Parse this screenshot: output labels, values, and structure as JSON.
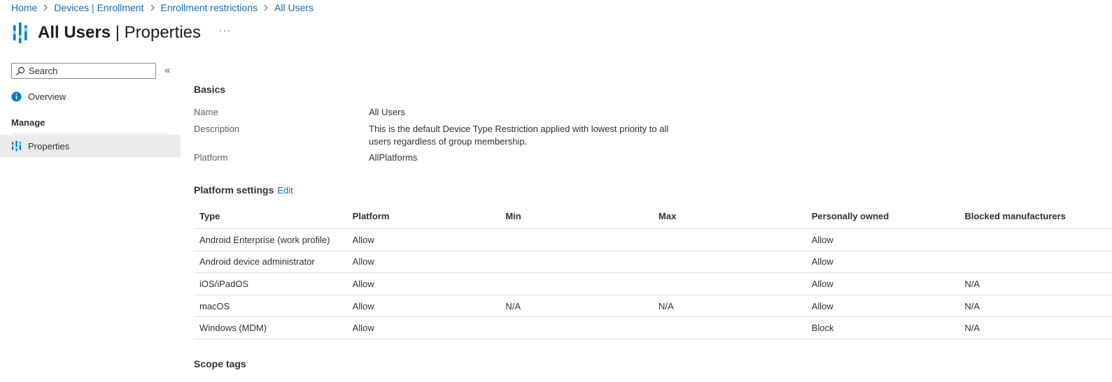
{
  "breadcrumb": [
    "Home",
    "Devices | Enrollment",
    "Enrollment restrictions",
    "All Users"
  ],
  "title": {
    "bold": "All Users",
    "separator": " | ",
    "rest": "Properties",
    "more": "···"
  },
  "sidebar": {
    "search_placeholder": "Search",
    "collapse": "«",
    "overview": "Overview",
    "manage": "Manage",
    "properties": "Properties"
  },
  "basics": {
    "heading": "Basics",
    "name_label": "Name",
    "name_value": "All Users",
    "description_label": "Description",
    "description_value": "This is the default Device Type Restriction applied with lowest priority to all users regardless of group membership.",
    "platform_label": "Platform",
    "platform_value": "AllPlatforms"
  },
  "platform_settings": {
    "heading": "Platform settings",
    "edit": "Edit",
    "columns": [
      "Type",
      "Platform",
      "Min",
      "Max",
      "Personally owned",
      "Blocked manufacturers"
    ],
    "rows": [
      [
        "Android Enterprise (work profile)",
        "Allow",
        "",
        "",
        "Allow",
        ""
      ],
      [
        "Android device administrator",
        "Allow",
        "",
        "",
        "Allow",
        ""
      ],
      [
        "iOS/iPadOS",
        "Allow",
        "",
        "",
        "Allow",
        "N/A"
      ],
      [
        "macOS",
        "Allow",
        "N/A",
        "N/A",
        "Allow",
        "N/A"
      ],
      [
        "Windows (MDM)",
        "Allow",
        "",
        "",
        "Block",
        "N/A"
      ]
    ]
  },
  "scope_tags": {
    "heading": "Scope tags"
  },
  "colors": {
    "link": "#0f6cbd",
    "icon_blue": "#0078d4",
    "icon_cyan": "#50e6ff",
    "selected_bg": "#ebebeb"
  }
}
